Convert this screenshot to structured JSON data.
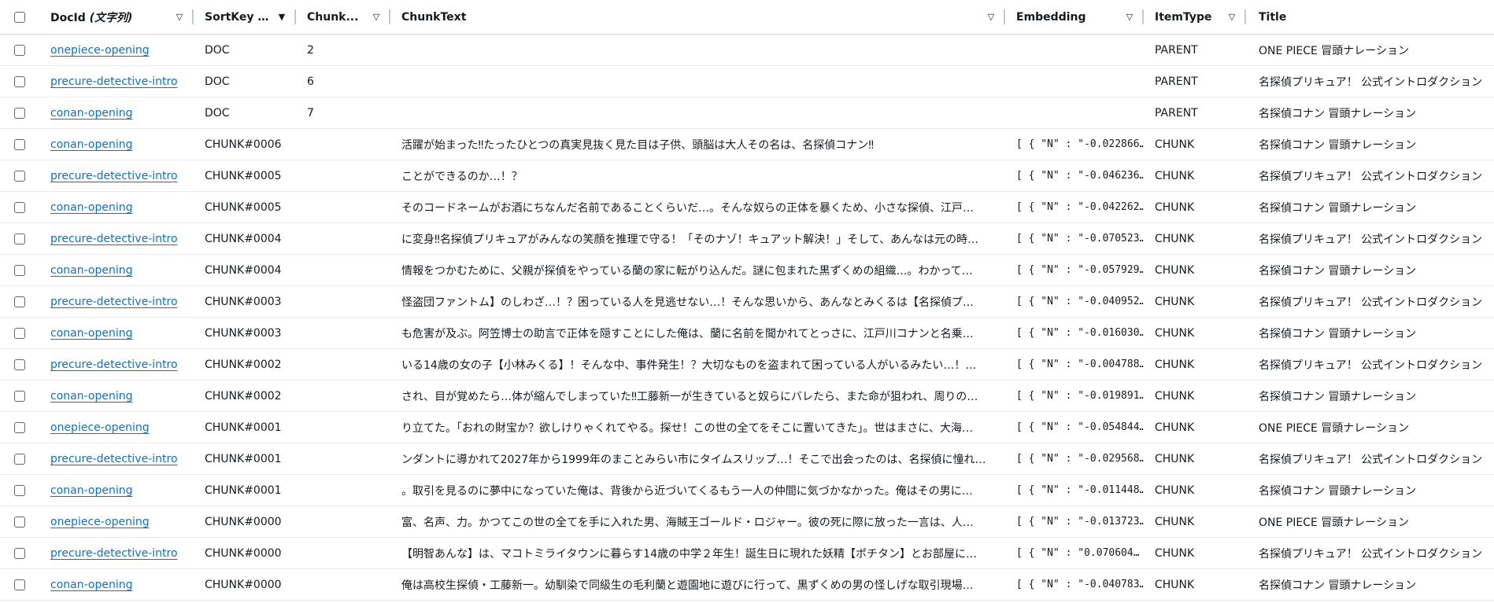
{
  "columns": [
    {
      "label": "DocId",
      "suffix": " (文字列)"
    },
    {
      "label": "SortKey (...",
      "suffix": ""
    },
    {
      "label": "Chunk...",
      "suffix": ""
    },
    {
      "label": "ChunkText",
      "suffix": ""
    },
    {
      "label": "Embedding",
      "suffix": ""
    },
    {
      "label": "ItemType",
      "suffix": ""
    },
    {
      "label": "Title",
      "suffix": ""
    }
  ],
  "sort_icons": {
    "docid": "▽",
    "sortkey": "▼",
    "chunk": "▽",
    "chunktext": "▽",
    "embedding": "▽",
    "itemtype": "▽"
  },
  "rows": [
    {
      "docid": "onepiece-opening",
      "sortkey": "DOC",
      "chunk": "2",
      "text": "",
      "emb": "",
      "type": "PARENT",
      "title": "ONE PIECE 冒頭ナレーション"
    },
    {
      "docid": "precure-detective-intro",
      "sortkey": "DOC",
      "chunk": "6",
      "text": "",
      "emb": "",
      "type": "PARENT",
      "title": "名探偵プリキュア！ 公式イントロダクション"
    },
    {
      "docid": "conan-opening",
      "sortkey": "DOC",
      "chunk": "7",
      "text": "",
      "emb": "",
      "type": "PARENT",
      "title": "名探偵コナン 冒頭ナレーション"
    },
    {
      "docid": "conan-opening",
      "sortkey": "CHUNK#0006",
      "chunk": "",
      "text": "活躍が始まった‼たったひとつの真実見抜く見た目は子供、頭脳は大人その名は、名探偵コナン‼",
      "emb": "[ { \"N\" : \"-0.022866…",
      "type": "CHUNK",
      "title": "名探偵コナン 冒頭ナレーション"
    },
    {
      "docid": "precure-detective-intro",
      "sortkey": "CHUNK#0005",
      "chunk": "",
      "text": "ことができるのか…！？",
      "emb": "[ { \"N\" : \"-0.046236…",
      "type": "CHUNK",
      "title": "名探偵プリキュア！ 公式イントロダクション"
    },
    {
      "docid": "conan-opening",
      "sortkey": "CHUNK#0005",
      "chunk": "",
      "text": "そのコードネームがお酒にちなんだ名前であることくらいだ…。そんな奴らの正体を暴くため、小さな探偵、江戸…",
      "emb": "[ { \"N\" : \"-0.042262…",
      "type": "CHUNK",
      "title": "名探偵コナン 冒頭ナレーション"
    },
    {
      "docid": "precure-detective-intro",
      "sortkey": "CHUNK#0004",
      "chunk": "",
      "text": "に変身‼名探偵プリキュアがみんなの笑顔を推理で守る！「そのナゾ！キュアット解決！」そして、あんなは元の時…",
      "emb": "[ { \"N\" : \"-0.070523…",
      "type": "CHUNK",
      "title": "名探偵プリキュア！ 公式イントロダクション"
    },
    {
      "docid": "conan-opening",
      "sortkey": "CHUNK#0004",
      "chunk": "",
      "text": "情報をつかむために、父親が探偵をやっている蘭の家に転がり込んだ。謎に包まれた黒ずくめの組織…。わかって…",
      "emb": "[ { \"N\" : \"-0.057929…",
      "type": "CHUNK",
      "title": "名探偵コナン 冒頭ナレーション"
    },
    {
      "docid": "precure-detective-intro",
      "sortkey": "CHUNK#0003",
      "chunk": "",
      "text": "怪盗団ファントム】のしわざ…！？困っている人を見逃せない…！そんな思いから、あんなとみくるは【名探偵プ…",
      "emb": "[ { \"N\" : \"-0.040952…",
      "type": "CHUNK",
      "title": "名探偵プリキュア！ 公式イントロダクション"
    },
    {
      "docid": "conan-opening",
      "sortkey": "CHUNK#0003",
      "chunk": "",
      "text": "も危害が及ぶ。阿笠博士の助言で正体を隠すことにした俺は、蘭に名前を聞かれてとっさに、江戸川コナンと名乗…",
      "emb": "[ { \"N\" : \"-0.016030…",
      "type": "CHUNK",
      "title": "名探偵コナン 冒頭ナレーション"
    },
    {
      "docid": "precure-detective-intro",
      "sortkey": "CHUNK#0002",
      "chunk": "",
      "text": "いる14歳の女の子【小林みくる】！そんな中、事件発生！？大切なものを盗まれて困っている人がいるみたい…！…",
      "emb": "[ { \"N\" : \"-0.004788…",
      "type": "CHUNK",
      "title": "名探偵プリキュア！ 公式イントロダクション"
    },
    {
      "docid": "conan-opening",
      "sortkey": "CHUNK#0002",
      "chunk": "",
      "text": "され、目が覚めたら…体が縮んでしまっていた‼工藤新一が生きていると奴らにバレたら、また命が狙われ、周りの…",
      "emb": "[ { \"N\" : \"-0.019891…",
      "type": "CHUNK",
      "title": "名探偵コナン 冒頭ナレーション"
    },
    {
      "docid": "onepiece-opening",
      "sortkey": "CHUNK#0001",
      "chunk": "",
      "text": "り立てた。｢おれの財宝か？欲しけりゃくれてやる。探せ！この世の全てをそこに置いてきた｣。世はまさに、大海…",
      "emb": "[ { \"N\" : \"-0.054844…",
      "type": "CHUNK",
      "title": "ONE PIECE 冒頭ナレーション"
    },
    {
      "docid": "precure-detective-intro",
      "sortkey": "CHUNK#0001",
      "chunk": "",
      "text": "ンダントに導かれて2027年から1999年のまことみらい市にタイムスリップ…！そこで出会ったのは、名探偵に憧れ…",
      "emb": "[ { \"N\" : \"-0.029568…",
      "type": "CHUNK",
      "title": "名探偵プリキュア！ 公式イントロダクション"
    },
    {
      "docid": "conan-opening",
      "sortkey": "CHUNK#0001",
      "chunk": "",
      "text": "。取引を見るのに夢中になっていた俺は、背後から近づいてくるもう一人の仲間に気づかなかった。俺はその男に…",
      "emb": "[ { \"N\" : \"-0.011448…",
      "type": "CHUNK",
      "title": "名探偵コナン 冒頭ナレーション"
    },
    {
      "docid": "onepiece-opening",
      "sortkey": "CHUNK#0000",
      "chunk": "",
      "text": "富、名声、力。かつてこの世の全てを手に入れた男、海賊王ゴールド・ロジャー。彼の死に際に放った一言は、人…",
      "emb": "[ { \"N\" : \"-0.013723…",
      "type": "CHUNK",
      "title": "ONE PIECE 冒頭ナレーション"
    },
    {
      "docid": "precure-detective-intro",
      "sortkey": "CHUNK#0000",
      "chunk": "",
      "text": "【明智あんな】は、マコトミライタウンに暮らす14歳の中学２年生！誕生日に現れた妖精【ポチタン】とお部屋に…",
      "emb": "[ { \"N\" : \"0.070604…",
      "type": "CHUNK",
      "title": "名探偵プリキュア！ 公式イントロダクション"
    },
    {
      "docid": "conan-opening",
      "sortkey": "CHUNK#0000",
      "chunk": "",
      "text": "俺は高校生探偵・工藤新一。幼馴染で同級生の毛利蘭と遊園地に遊びに行って、黒ずくめの男の怪しげな取引現場…",
      "emb": "[ { \"N\" : \"-0.040783…",
      "type": "CHUNK",
      "title": "名探偵コナン 冒頭ナレーション"
    }
  ]
}
